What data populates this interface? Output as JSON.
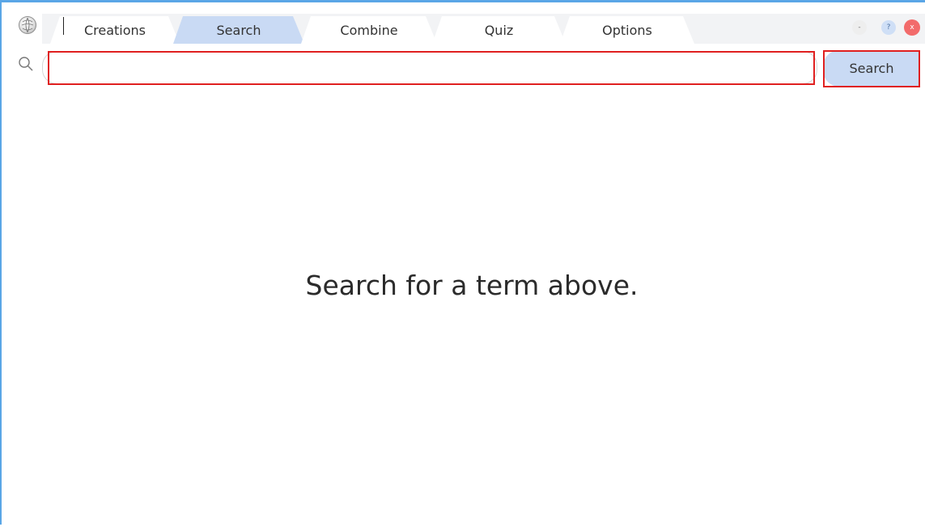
{
  "tabs": [
    {
      "label": "Creations",
      "active": false
    },
    {
      "label": "Search",
      "active": true
    },
    {
      "label": "Combine",
      "active": false
    },
    {
      "label": "Quiz",
      "active": false
    },
    {
      "label": "Options",
      "active": false
    }
  ],
  "window_controls": {
    "minimize_label": "-",
    "help_label": "?",
    "close_label": "x"
  },
  "search": {
    "value": "",
    "button_label": "Search"
  },
  "main": {
    "empty_message": "Search for a term above."
  },
  "colors": {
    "accent": "#c9daf4",
    "window_border": "#5aa6e6",
    "highlight": "#e02020",
    "close": "#f26b6b"
  }
}
